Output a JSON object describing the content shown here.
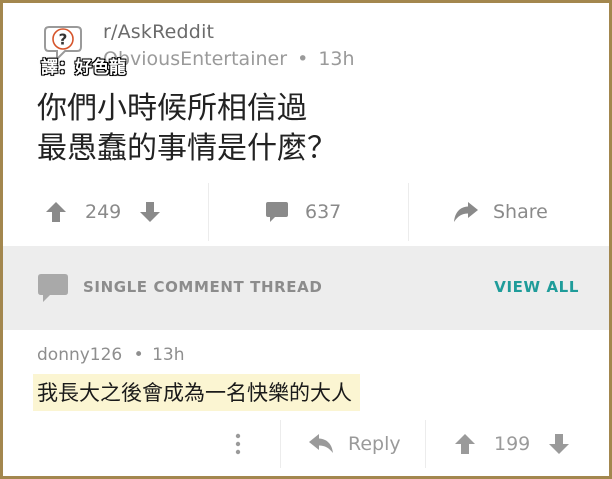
{
  "post": {
    "subreddit": "r/AskReddit",
    "author": "ObviousEntertainer",
    "separator": "•",
    "age": "13h",
    "watermark": "譯：好色龍",
    "title_line1": "你們小時候所相信過",
    "title_line2": "最愚蠢的事情是什麼？",
    "upvotes": "249",
    "comments": "637",
    "share_label": "Share"
  },
  "thread_band": {
    "label": "SINGLE COMMENT THREAD",
    "link": "VIEW ALL"
  },
  "comment": {
    "author": "donny126",
    "separator": "•",
    "age": "13h",
    "text": "我長大之後會成為一名快樂的大人",
    "reply_label": "Reply",
    "score": "199"
  },
  "icons": {
    "subreddit": "question-bubble-icon",
    "upvote": "arrow-up-icon",
    "downvote": "arrow-down-icon",
    "comments": "comment-bubble-icon",
    "share": "share-arrow-icon",
    "more": "vertical-dots-icon",
    "reply": "reply-arrow-icon"
  },
  "colors": {
    "frame": "#a3874e",
    "accent": "#1f9c9a",
    "band_bg": "#ededed",
    "highlight": "#fbf5d2",
    "icon_gray": "#8a8a8a"
  }
}
